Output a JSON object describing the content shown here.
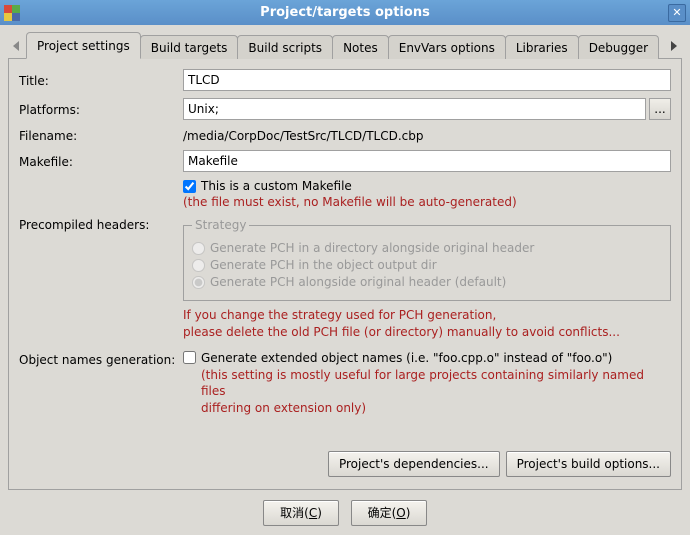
{
  "title": "Project/targets options",
  "tabs": [
    {
      "label": "Project settings",
      "active": true
    },
    {
      "label": "Build targets"
    },
    {
      "label": "Build scripts"
    },
    {
      "label": "Notes"
    },
    {
      "label": "EnvVars options"
    },
    {
      "label": "Libraries"
    },
    {
      "label": "Debugger"
    }
  ],
  "form": {
    "title_label": "Title:",
    "title_value": "TLCD",
    "platforms_label": "Platforms:",
    "platforms_value": "Unix;",
    "platforms_browse": "...",
    "filename_label": "Filename:",
    "filename_value": "/media/CorpDoc/TestSrc/TLCD/TLCD.cbp",
    "makefile_label": "Makefile:",
    "makefile_value": "Makefile",
    "custom_makefile_checked": true,
    "custom_makefile_label": "This is a custom Makefile",
    "custom_makefile_note": "(the file must exist, no Makefile will be auto-generated)",
    "pch_label": "Precompiled headers:",
    "pch_legend": "Strategy",
    "pch_options": [
      {
        "label": "Generate PCH in a directory alongside original header",
        "checked": false
      },
      {
        "label": "Generate PCH in the object output dir",
        "checked": false
      },
      {
        "label": "Generate PCH alongside original header (default)",
        "checked": true
      }
    ],
    "pch_warning_l1": "If you change the strategy used for PCH generation,",
    "pch_warning_l2": "please delete the old PCH file (or directory) manually to avoid conflicts...",
    "obj_label": "Object names generation:",
    "obj_checkbox_label": "Generate extended object names (i.e. \"foo.cpp.o\" instead of \"foo.o\")",
    "obj_checkbox_checked": false,
    "obj_note_l1": "(this setting is mostly useful for large projects containing similarly named files",
    "obj_note_l2": "differing on extension only)",
    "deps_btn": "Project's dependencies...",
    "build_opts_btn": "Project's build options..."
  },
  "dialog": {
    "cancel_text": "取消",
    "cancel_mnemonic": "C",
    "ok_text": "确定",
    "ok_mnemonic": "O"
  }
}
